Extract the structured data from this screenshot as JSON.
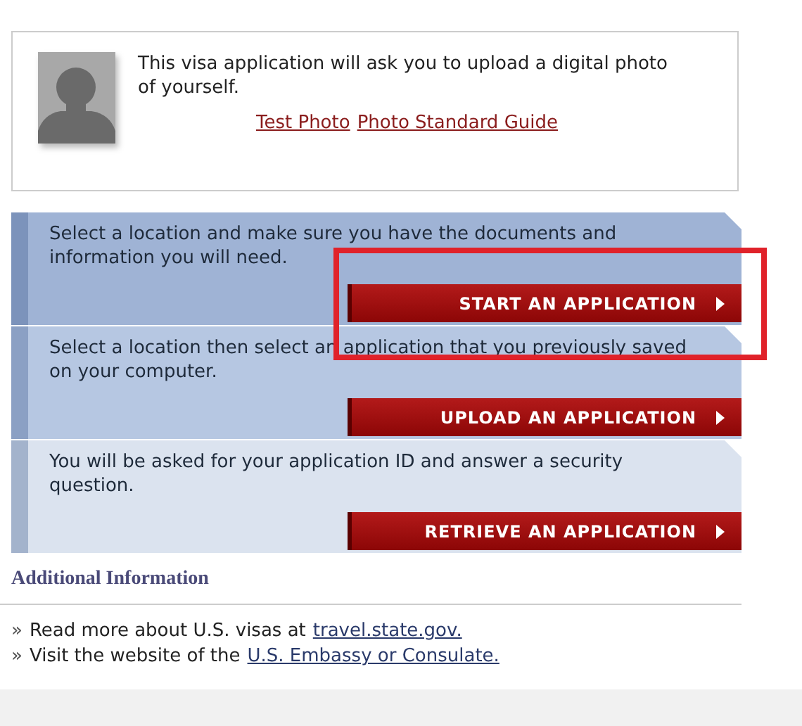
{
  "photo_notice": {
    "text": "This visa application will ask you to upload a digital photo of yourself.",
    "links": [
      "Test Photo",
      "Photo Standard Guide"
    ]
  },
  "actions": [
    {
      "text": "Select a location and make sure you have the documents and information you will need.",
      "button": "START AN APPLICATION",
      "color": "#9fb3d5",
      "highlighted": true
    },
    {
      "text": "Select a location then select an application that you previously saved on your computer.",
      "button": "UPLOAD AN APPLICATION",
      "color": "#b6c7e2",
      "highlighted": false
    },
    {
      "text": "You will be asked for your application ID and answer a security question.",
      "button": "RETRIEVE AN APPLICATION",
      "color": "#dbe3ef",
      "highlighted": false
    }
  ],
  "additional_information": {
    "heading": "Additional Information",
    "items": [
      {
        "bullet": "»",
        "text": "Read more about U.S. visas at",
        "link": "travel.state.gov."
      },
      {
        "bullet": "»",
        "text": "Visit the website of the",
        "link": "U.S. Embassy or Consulate."
      }
    ]
  }
}
